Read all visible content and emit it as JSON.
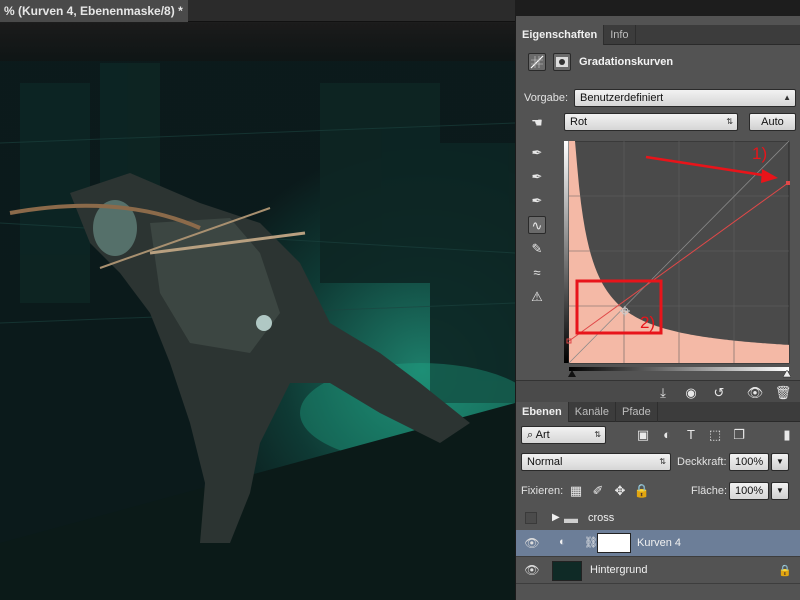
{
  "document": {
    "tab_title": "% (Kurven 4, Ebenenmaske/8) *"
  },
  "properties_panel": {
    "tabs": [
      {
        "label": "Eigenschaften",
        "active": true
      },
      {
        "label": "Info",
        "active": false
      }
    ],
    "title": "Gradationskurven",
    "preset_label": "Vorgabe:",
    "preset_value": "Benutzerdefiniert",
    "channel_value": "Rot",
    "auto_button": "Auto",
    "annotation_1": "1)",
    "annotation_2": "2)",
    "tools": [
      "sample-black-icon",
      "sample-gray-icon",
      "sample-white-icon",
      "curve-point-icon",
      "pencil-icon",
      "smooth-icon",
      "clipping-warning-icon"
    ]
  },
  "layers_panel": {
    "tabs": [
      {
        "label": "Ebenen",
        "active": true
      },
      {
        "label": "Kanäle",
        "active": false
      },
      {
        "label": "Pfade",
        "active": false
      }
    ],
    "filter_kind": "Art",
    "blend_mode": "Normal",
    "opacity_label": "Deckkraft:",
    "opacity_value": "100%",
    "lock_label": "Fixieren:",
    "fill_label": "Fläche:",
    "fill_value": "100%",
    "layers": [
      {
        "name": "cross",
        "type": "group",
        "visible": false
      },
      {
        "name": "Kurven 4",
        "type": "adjustment",
        "visible": true,
        "selected": true
      },
      {
        "name": "Hintergrund",
        "type": "pixel",
        "visible": true,
        "locked": true
      }
    ]
  },
  "colors": {
    "panel_bg": "#535353",
    "annotation_red": "#e8141a",
    "histogram_fill": "#f4b9a6",
    "selected_layer": "#6c7e98"
  }
}
